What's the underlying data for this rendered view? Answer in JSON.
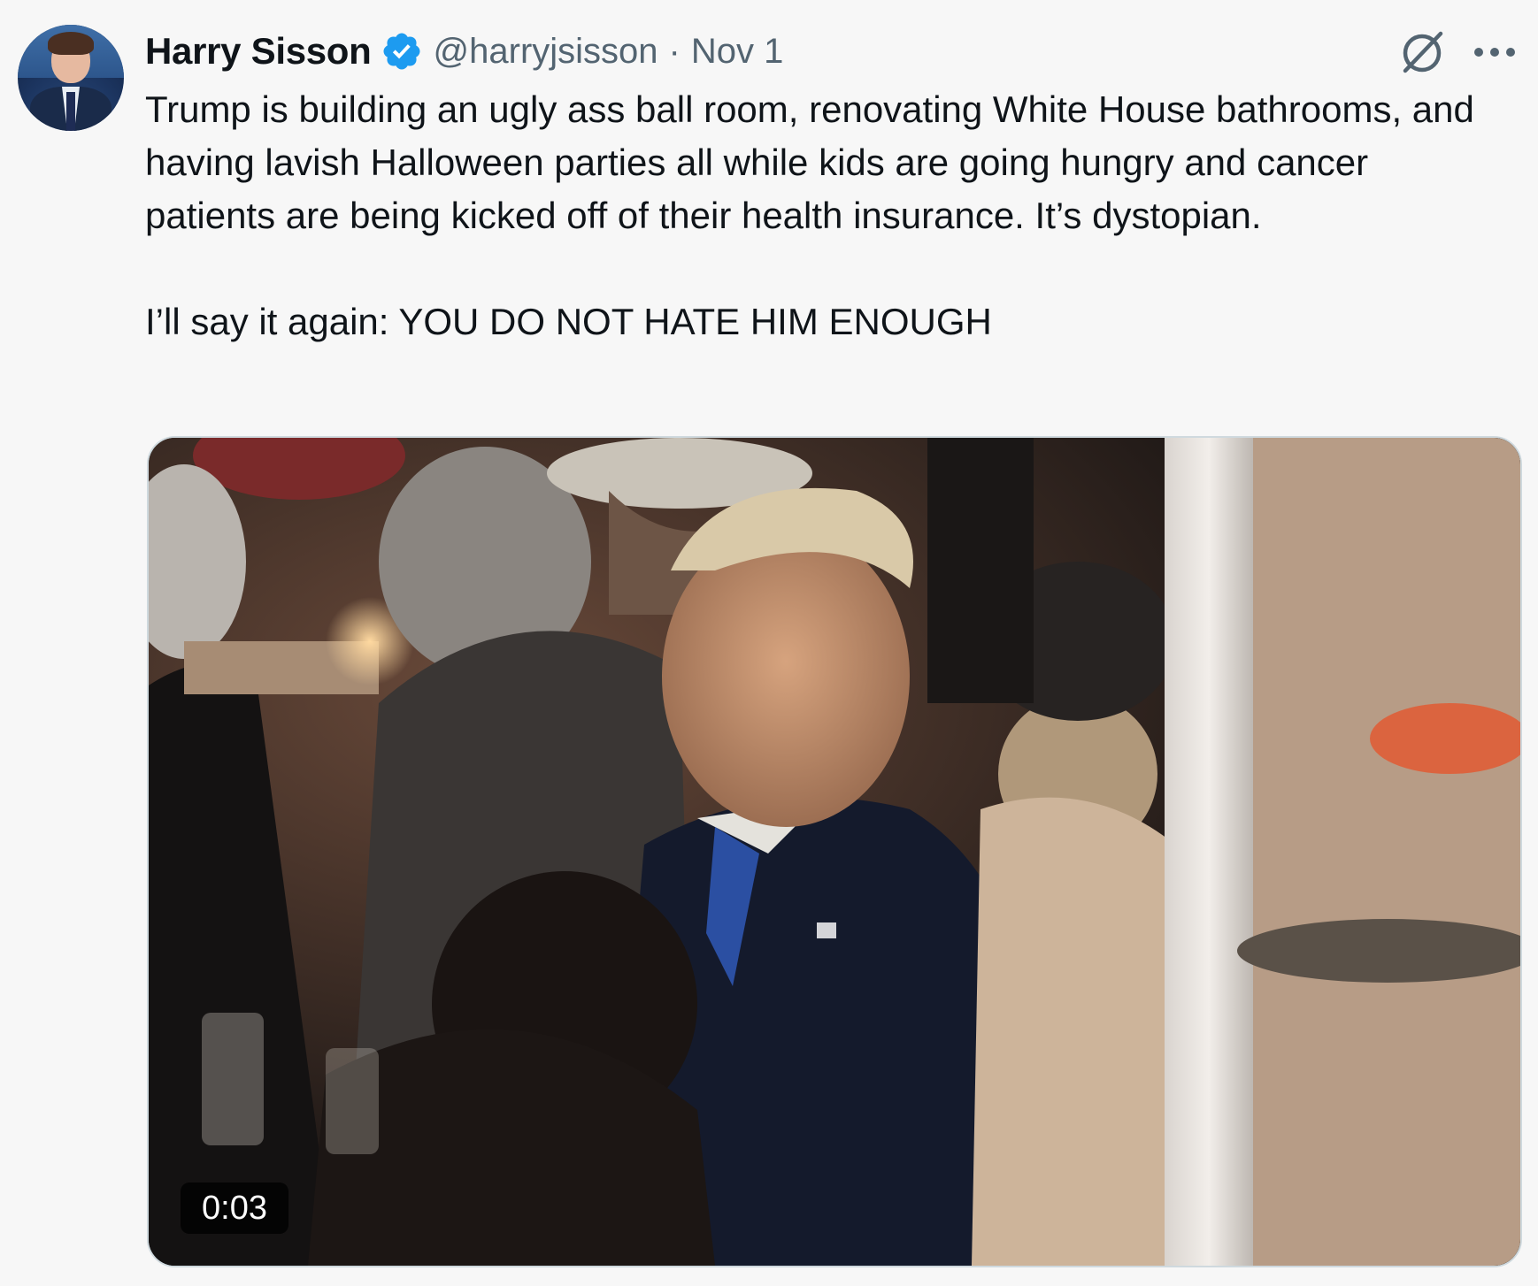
{
  "author": {
    "display_name": "Harry Sisson",
    "handle": "@harryjsisson",
    "separator": "·",
    "date": "Nov 1",
    "verified": true,
    "avatar_icon": "avatar-photo"
  },
  "tweet": {
    "paragraphs": [
      "Trump is building an ugly ass ball room, renovating White House bathrooms, and having lavish Halloween parties all while kids are going hungry and cancer patients are being kicked off of their health insurance. It’s dystopian.",
      "I’ll say it again: YOU DO NOT HATE HIM ENOUGH"
    ]
  },
  "media": {
    "type": "video",
    "duration": "0:03"
  },
  "icons": {
    "verified": "verified-badge-icon",
    "grok": "grok-icon",
    "more": "more-options-icon"
  },
  "colors": {
    "verified_blue": "#1d9bf0",
    "text_primary": "#0f1419",
    "text_secondary": "#536471",
    "background": "#f7f7f7"
  }
}
